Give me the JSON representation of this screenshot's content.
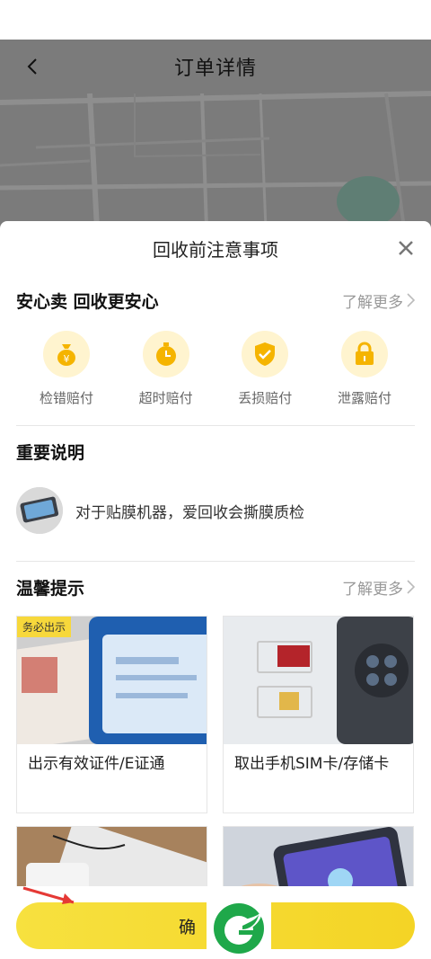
{
  "page": {
    "title": "订单详情"
  },
  "sheet": {
    "title": "回收前注意事项",
    "safety": {
      "title": "安心卖 回收更安心",
      "more": "了解更多",
      "items": [
        {
          "label": "检错赔付",
          "icon": "money-bag-icon"
        },
        {
          "label": "超时赔付",
          "icon": "stopwatch-icon"
        },
        {
          "label": "丢损赔付",
          "icon": "shield-check-icon"
        },
        {
          "label": "泄露赔付",
          "icon": "lock-icon"
        }
      ]
    },
    "important": {
      "title": "重要说明",
      "text": "对于贴膜机器，爱回收会撕膜质检"
    },
    "tips": {
      "title": "温馨提示",
      "more": "了解更多",
      "cards": [
        {
          "text": "出示有效证件/E证通",
          "badge": "务必出示"
        },
        {
          "text": "取出手机SIM卡/存储卡"
        }
      ]
    }
  },
  "bottom": {
    "confirm_label": "确"
  },
  "colors": {
    "accent": "#f7d83b",
    "icon_bg": "#fff4cf",
    "icon_fg": "#f5b400"
  }
}
